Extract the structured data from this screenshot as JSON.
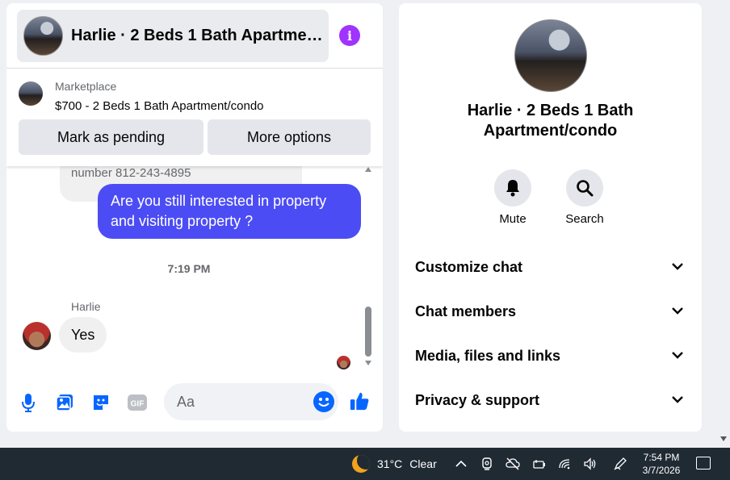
{
  "chat": {
    "title": "Harlie · 2 Beds 1 Bath Apartment/condo",
    "marketplace_label": "Marketplace",
    "listing": "$700 - 2 Beds 1 Bath Apartment/condo",
    "mark_pending_label": "Mark as pending",
    "more_options_label": "More options",
    "partial_message": "number 812-243-4895",
    "outgoing_message": "Are you still interested in property and visiting property ?",
    "timestamp": "7:19 PM",
    "sender": "Harlie",
    "incoming_message": "Yes",
    "composer_placeholder": "Aa"
  },
  "info": {
    "title": "Harlie · 2 Beds 1 Bath Apartment/condo",
    "mute_label": "Mute",
    "search_label": "Search",
    "sections": [
      "Customize chat",
      "Chat members",
      "Media, files and links",
      "Privacy & support"
    ]
  },
  "taskbar": {
    "temperature": "31°C",
    "condition": "Clear",
    "time": "7:54 PM",
    "date": "3/7/2026"
  },
  "colors": {
    "accent": "#0866ff",
    "outgoing_bubble": "#4c4cf5",
    "info_icon": "#a033ff"
  }
}
